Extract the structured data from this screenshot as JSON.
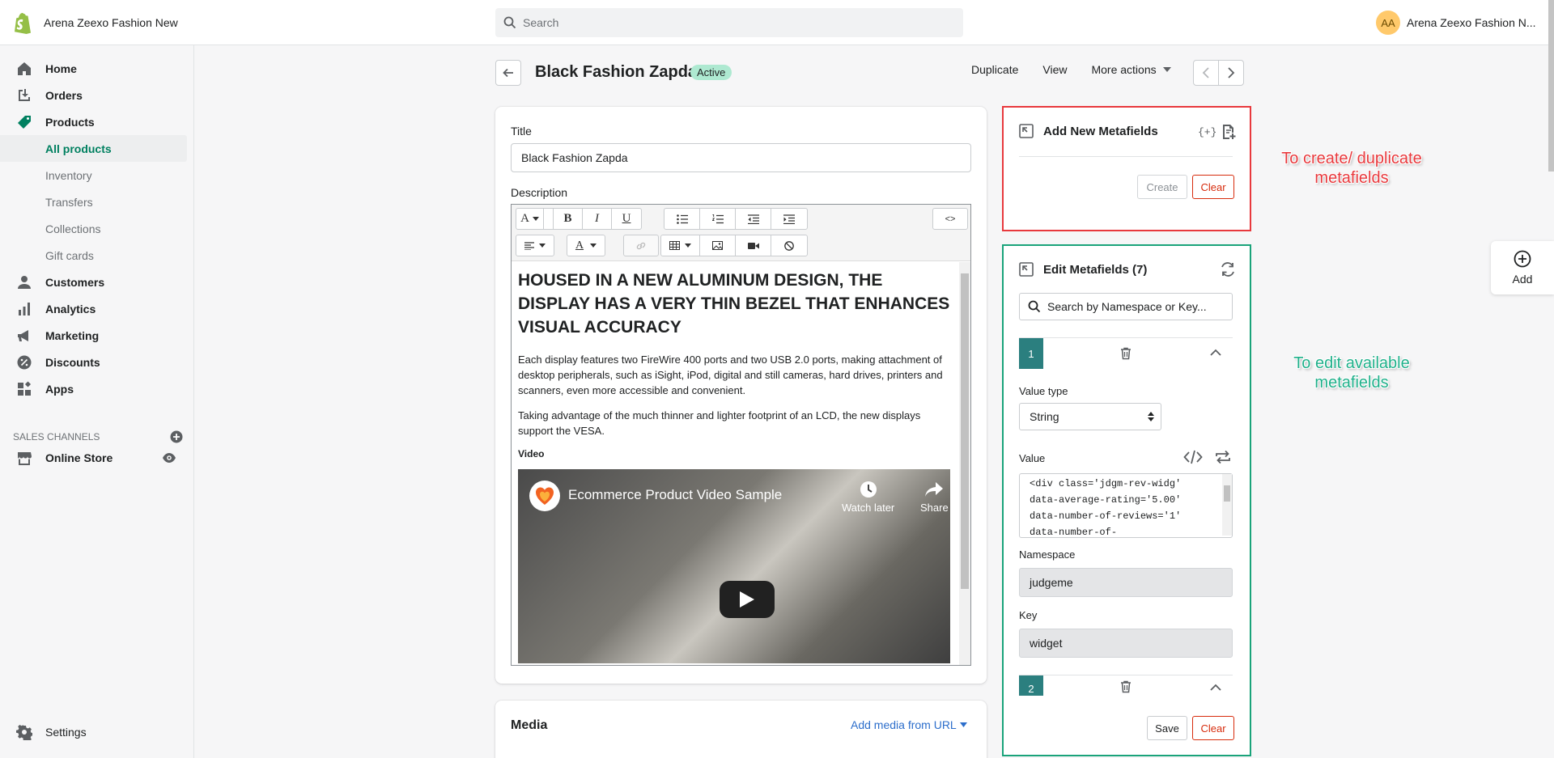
{
  "topbar": {
    "store_name": "Arena Zeexo Fashion New",
    "search_placeholder": "Search",
    "user_initials": "AA",
    "user_name": "Arena Zeexo Fashion N..."
  },
  "sidebar": {
    "items": [
      {
        "label": "Home",
        "icon": "home-icon"
      },
      {
        "label": "Orders",
        "icon": "orders-icon"
      },
      {
        "label": "Products",
        "icon": "tag-icon"
      },
      {
        "label": "All products"
      },
      {
        "label": "Inventory"
      },
      {
        "label": "Transfers"
      },
      {
        "label": "Collections"
      },
      {
        "label": "Gift cards"
      },
      {
        "label": "Customers",
        "icon": "person-icon"
      },
      {
        "label": "Analytics",
        "icon": "bar-chart-icon"
      },
      {
        "label": "Marketing",
        "icon": "megaphone-icon"
      },
      {
        "label": "Discounts",
        "icon": "discount-icon"
      },
      {
        "label": "Apps",
        "icon": "apps-icon"
      }
    ],
    "sales_channels_label": "SALES CHANNELS",
    "online_store_label": "Online Store",
    "settings_label": "Settings",
    "accent_color": "#008060"
  },
  "header": {
    "title": "Black Fashion Zapda",
    "status": "Active",
    "duplicate_label": "Duplicate",
    "view_label": "View",
    "more_actions_label": "More actions"
  },
  "product": {
    "title_label": "Title",
    "title_value": "Black Fashion Zapda",
    "description_label": "Description",
    "code_toggle": "<>",
    "heading": "HOUSED IN A NEW ALUMINUM DESIGN, THE DISPLAY HAS A VERY THIN BEZEL THAT ENHANCES VISUAL ACCURACY",
    "paragraph1": "Each display features two FireWire 400 ports and two USB 2.0 ports, making attachment of desktop peripherals, such as iSight, iPod, digital and still cameras, hard drives, printers and scanners, even more accessible and convenient.",
    "paragraph2": "Taking advantage of the much thinner and lighter footprint of an LCD, the new displays support the VESA.",
    "video_label": "Video",
    "video_title": "Ecommerce Product Video Sample",
    "watch_later": "Watch later",
    "share": "Share"
  },
  "media": {
    "title": "Media",
    "add_from_url": "Add media from URL"
  },
  "add_metafields": {
    "title": "Add New Metafields",
    "create_label": "Create",
    "clear_label": "Clear"
  },
  "edit_metafields": {
    "title": "Edit Metafields (7)",
    "search_placeholder": "Search by Namespace or Key...",
    "item1_index": "1",
    "item2_index": "2",
    "value_type_label": "Value type",
    "value_type": "String",
    "value_label": "Value",
    "value_text": "<div class='jdgm-rev-widg'\ndata-average-rating='5.00'\ndata-number-of-reviews='1'\ndata-number-of-",
    "namespace_label": "Namespace",
    "namespace_value": "judgeme",
    "key_label": "Key",
    "key_value": "widget",
    "save_label": "Save",
    "clear_label": "Clear"
  },
  "annotations": {
    "create_note_line1": "To create/ duplicate",
    "create_note_line2": "metafields",
    "edit_note_line1": "To edit available",
    "edit_note_line2": "metafields",
    "red": "#e8393d",
    "green": "#1aa37a"
  },
  "floating": {
    "add_label": "Add"
  }
}
